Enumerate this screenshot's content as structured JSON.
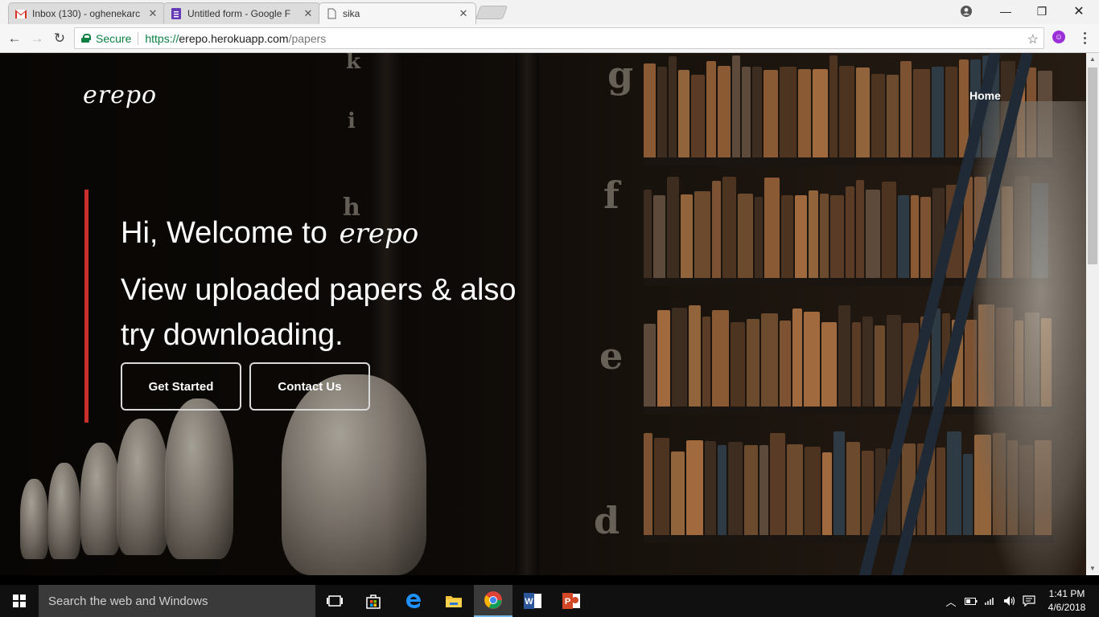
{
  "browser": {
    "tabs": [
      {
        "title": "Inbox (130) - oghenekarc",
        "icon": "gmail-icon",
        "active": false
      },
      {
        "title": "Untitled form - Google F",
        "icon": "google-forms-icon",
        "active": false
      },
      {
        "title": "sika",
        "icon": "page-icon",
        "active": true
      }
    ],
    "secure_label": "Secure",
    "url_scheme": "https://",
    "url_host": "erepo.herokuapp.com",
    "url_path": "/papers",
    "extension_label": "☺"
  },
  "page": {
    "brand": "erepo",
    "nav_home": "Home",
    "headline_prefix": "Hi, Welcome to",
    "headline_brand": "erepo",
    "subheadline": "View uploaded papers & also try downloading.",
    "get_started": "Get Started",
    "contact_us": "Contact Us",
    "accent_color": "#c9302c"
  },
  "taskbar": {
    "search_placeholder": "Search the web and Windows",
    "time": "1:41 PM",
    "date": "4/6/2018",
    "apps": [
      "task-view",
      "store",
      "edge",
      "file-explorer",
      "chrome",
      "word",
      "powerpoint"
    ]
  }
}
